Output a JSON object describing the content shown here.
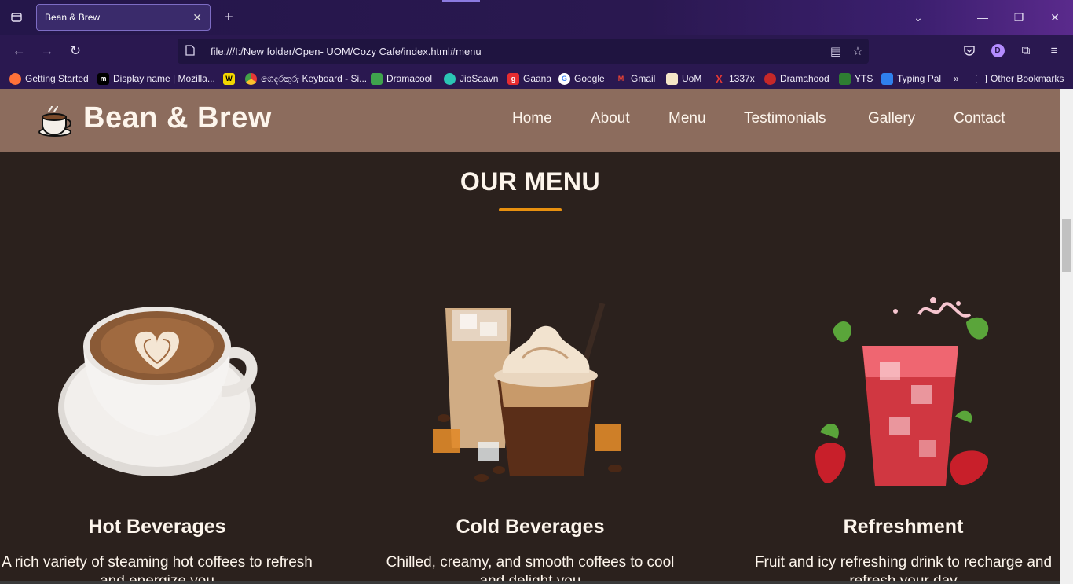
{
  "browser": {
    "tab_title": "Bean & Brew",
    "url": "file:///I:/New folder/Open- UOM/Cozy Cafe/index.html#menu",
    "bookmarks": [
      {
        "label": "Getting Started",
        "color": "#ff7139",
        "glyph": ""
      },
      {
        "label": "Display name | Mozilla...",
        "color": "#000000",
        "glyph": "m"
      },
      {
        "label": "",
        "color": "#f2d600",
        "glyph": "W"
      },
      {
        "label": "ගෙදරකුරු Keyboard - Si...",
        "color": "#e53935",
        "glyph": ""
      },
      {
        "label": "Dramacool",
        "color": "#3fa34d",
        "glyph": ""
      },
      {
        "label": "JioSaavn",
        "color": "#2bc5b4",
        "glyph": ""
      },
      {
        "label": "Gaana",
        "color": "#e72c30",
        "glyph": "g"
      },
      {
        "label": "Google",
        "color": "#ffffff",
        "glyph": "G"
      },
      {
        "label": "Gmail",
        "color": "#ffffff",
        "glyph": "M"
      },
      {
        "label": "UoM",
        "color": "#f5e6c8",
        "glyph": ""
      },
      {
        "label": "1337x",
        "color": "#e53935",
        "glyph": "X"
      },
      {
        "label": "Dramahood",
        "color": "#c62828",
        "glyph": ""
      },
      {
        "label": "YTS",
        "color": "#2e7d32",
        "glyph": ""
      },
      {
        "label": "Typing Pal",
        "color": "#2f80ed",
        "glyph": ""
      }
    ],
    "other_bookmarks": "Other Bookmarks",
    "avatar_letter": "D"
  },
  "site": {
    "brand": "Bean & Brew",
    "nav": [
      "Home",
      "About",
      "Menu",
      "Testimonials",
      "Gallery",
      "Contact"
    ],
    "section_title": "OUR MENU",
    "cards": [
      {
        "title": "Hot Beverages",
        "desc": "A rich variety of steaming hot coffees to refresh and energize you"
      },
      {
        "title": "Cold Beverages",
        "desc": "Chilled, creamy, and smooth coffees to cool and delight you"
      },
      {
        "title": "Refreshment",
        "desc": "Fruit and icy refreshing drink to recharge and refresh your day"
      }
    ]
  },
  "colors": {
    "header_bg": "#8c6c5d",
    "page_bg": "#2b211d",
    "accent": "#e8900f",
    "text": "#fdf5ec"
  }
}
